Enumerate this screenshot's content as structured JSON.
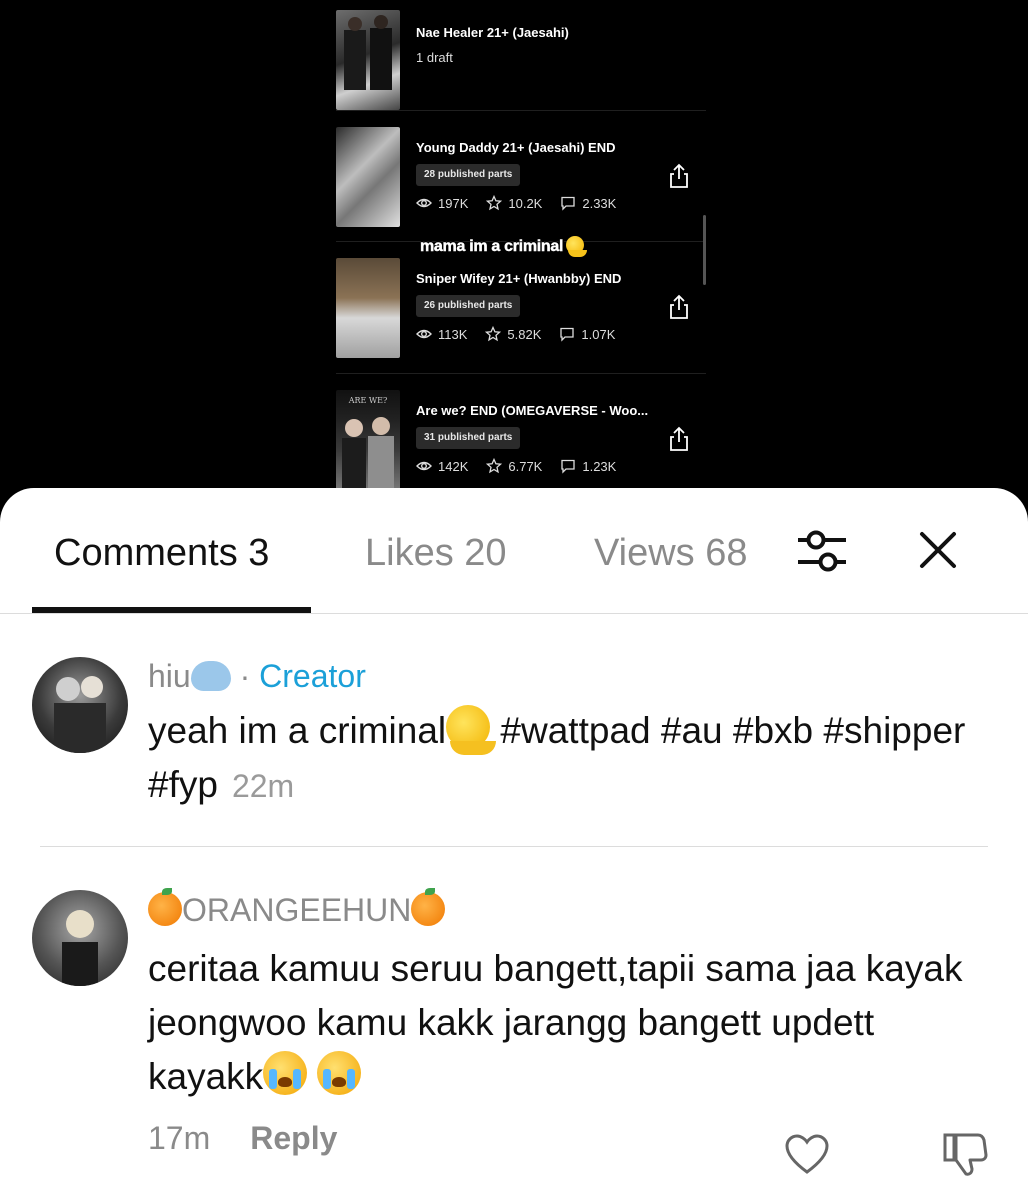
{
  "stories": [
    {
      "title": "Nae Healer 21+ (Jaesahi)",
      "subtext": "1 draft"
    },
    {
      "title": "Young Daddy 21+ (Jaesahi) END",
      "parts": "28 published parts",
      "views": "197K",
      "stars": "10.2K",
      "comments": "2.33K"
    },
    {
      "title": "Sniper Wifey 21+ (Hwanbby) END",
      "parts": "26 published parts",
      "views": "113K",
      "stars": "5.82K",
      "comments": "1.07K"
    },
    {
      "title": "Are we? END (OMEGAVERSE - Woo...",
      "parts": "31 published parts",
      "views": "142K",
      "stars": "6.77K",
      "comments": "1.23K",
      "cover_text": "ARE WE?"
    }
  ],
  "overlay_caption": "mama im a criminal",
  "tabs": {
    "comments": "Comments 3",
    "likes": "Likes 20",
    "views": "Views 68"
  },
  "comments": [
    {
      "author": "hiu",
      "separator": "·",
      "badge": "Creator",
      "text_part1": "yeah im a criminal",
      "text_part2": " #wattpad #au #bxb #shipper #fyp",
      "time": "22m"
    },
    {
      "author": "ORANGEEHUN",
      "text": "ceritaa kamuu seruu bangett,tapii sama jaa kayak jeongwoo kamu kakk jarangg bangett updett kayakk",
      "time": "17m",
      "reply_label": "Reply"
    }
  ],
  "icons": [
    "eye-icon",
    "star-icon",
    "comment-icon",
    "share-icon",
    "filter-icon",
    "close-icon",
    "heart-icon",
    "dislike-icon"
  ],
  "colors": {
    "creator": "#1ba0d8",
    "muted": "#8a8a8a",
    "text": "#111111"
  }
}
